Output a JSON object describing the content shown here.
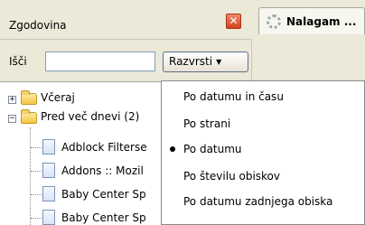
{
  "sidebar": {
    "title": "Zgodovina",
    "close_glyph": "✕",
    "search": {
      "label": "Išči",
      "value": "",
      "placeholder": ""
    },
    "sort_button": {
      "label": "Razvrsti",
      "caret": "▼"
    }
  },
  "tree": {
    "groups": [
      {
        "label": "Včeraj",
        "expanded": false,
        "toggle": "+"
      },
      {
        "label": "Pred več dnevi (2)",
        "expanded": true,
        "toggle": "−"
      }
    ],
    "items": [
      {
        "label": "Adblock Filterse"
      },
      {
        "label": "Addons :: Mozil"
      },
      {
        "label": "Baby Center Sp"
      },
      {
        "label": "Baby Center Sp"
      }
    ]
  },
  "tab": {
    "label": "Nalagam ..."
  },
  "sort_menu": {
    "items": [
      {
        "label": "Po datumu in času",
        "selected": false
      },
      {
        "label": "Po strani",
        "selected": false
      },
      {
        "label": "Po datumu",
        "selected": true
      },
      {
        "label": "Po številu obiskov",
        "selected": false
      },
      {
        "label": "Po datumu zadnjega obiska",
        "selected": false
      }
    ]
  },
  "colors": {
    "chrome": "#ece9d8",
    "close_red": "#d4421d",
    "folder_yellow": "#f5c542"
  }
}
